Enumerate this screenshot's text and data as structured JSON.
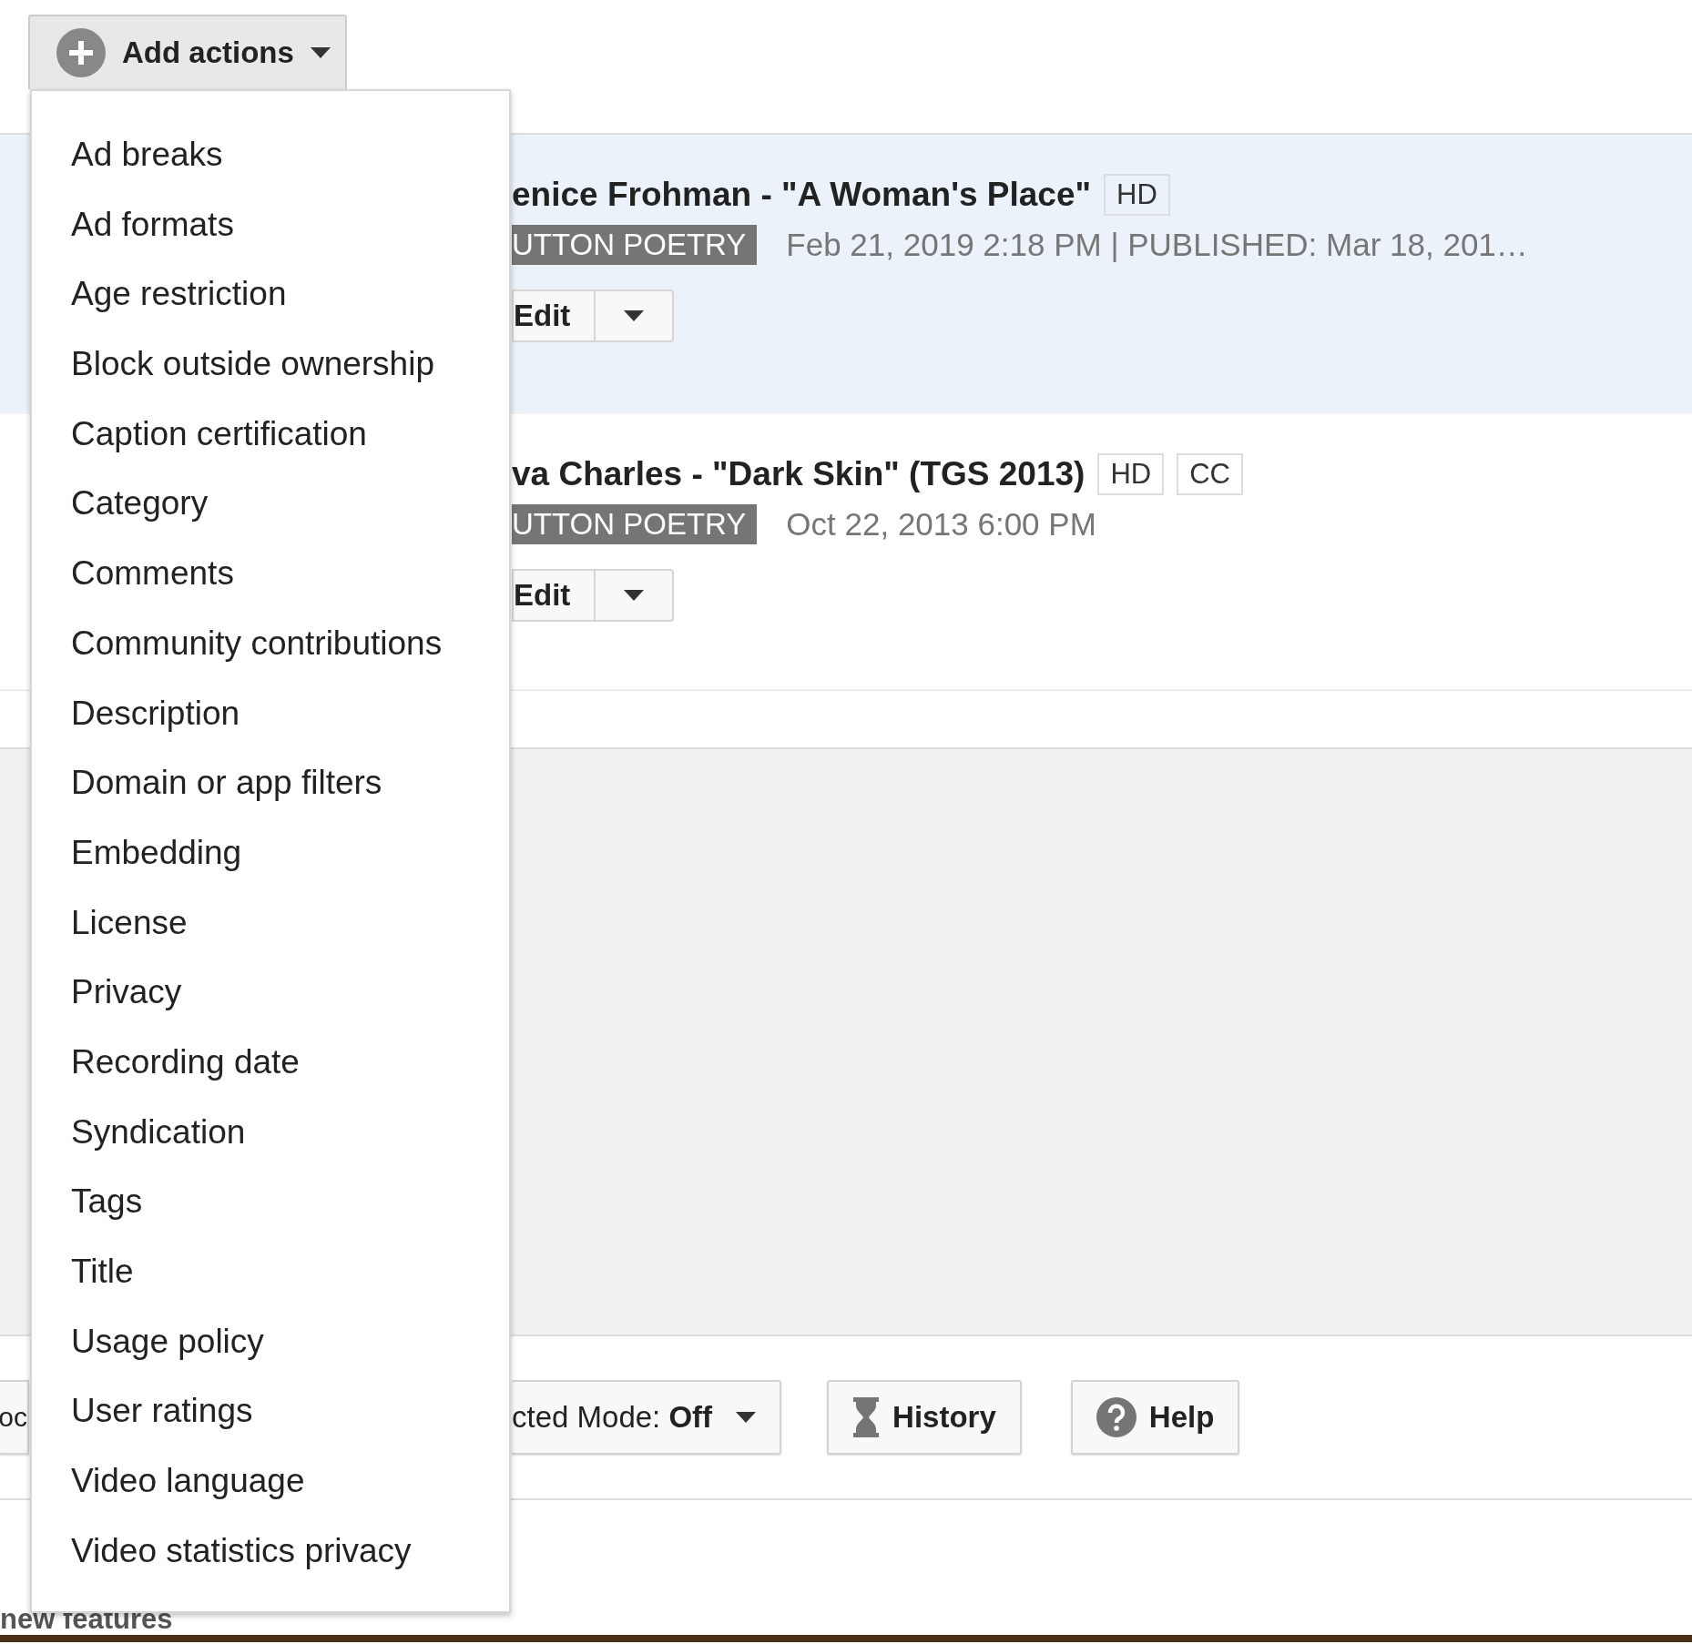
{
  "add_actions_button": {
    "label": "Add actions"
  },
  "actions_menu": {
    "items": [
      "Ad breaks",
      "Ad formats",
      "Age restriction",
      "Block outside ownership",
      "Caption certification",
      "Category",
      "Comments",
      "Community contributions",
      "Description",
      "Domain or app filters",
      "Embedding",
      "License",
      "Privacy",
      "Recording date",
      "Syndication",
      "Tags",
      "Title",
      "Usage policy",
      "User ratings",
      "Video language",
      "Video statistics privacy"
    ]
  },
  "videos": [
    {
      "title": "enice Frohman - \"A Woman's Place\"",
      "badges": [
        "HD"
      ],
      "channel": "UTTON POETRY",
      "date": "Feb 21, 2019 2:18 PM | PUBLISHED: Mar 18, 201…",
      "edit_label": "Edit",
      "selected": true
    },
    {
      "title": "va Charles - \"Dark Skin\" (TGS 2013)",
      "badges": [
        "HD",
        "CC"
      ],
      "channel": "UTTON POETRY",
      "date": "Oct 22, 2013 6:00 PM",
      "edit_label": "Edit",
      "selected": false
    }
  ],
  "toolbar": {
    "buttons": [
      {
        "kind": "cut",
        "label": "oc"
      },
      {
        "kind": "dropdown",
        "label": "cted Mode: **Off**"
      },
      {
        "kind": "history",
        "label": "History"
      },
      {
        "kind": "help",
        "label": "Help"
      }
    ]
  },
  "footer": {
    "link": "new features"
  }
}
